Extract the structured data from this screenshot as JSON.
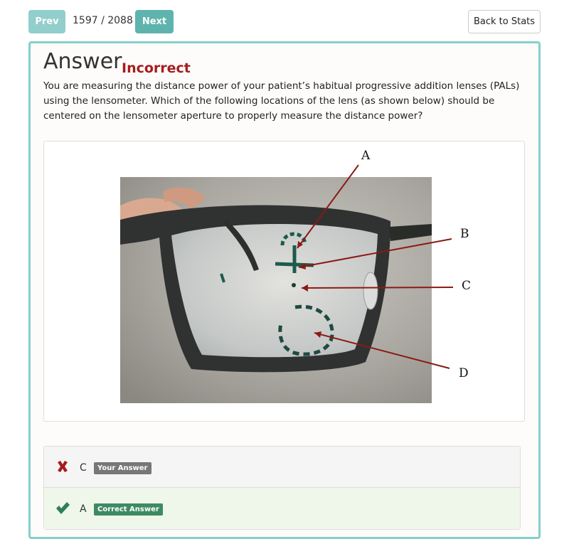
{
  "nav": {
    "prev_label": "Prev",
    "next_label": "Next",
    "counter": "1597 / 2088",
    "back_label": "Back to Stats"
  },
  "answer": {
    "heading": "Answer",
    "status": "Incorrect",
    "question": "You are measuring the distance power of your patient’s habitual progressive addition lenses (PALs) using the lensometer. Which of the following locations of the lens (as shown below) should be centered on the lensometer aperture to properly measure the distance power?"
  },
  "figure": {
    "labels": [
      "A",
      "B",
      "C",
      "D"
    ]
  },
  "choices": [
    {
      "letter": "C",
      "badge": "Your Answer",
      "result": "wrong",
      "icon": "x-icon"
    },
    {
      "letter": "A",
      "badge": "Correct Answer",
      "result": "right",
      "icon": "check-icon"
    }
  ],
  "colors": {
    "accent": "#5fb3ad",
    "incorrect": "#a51d1d",
    "correct": "#2f7d5b"
  }
}
